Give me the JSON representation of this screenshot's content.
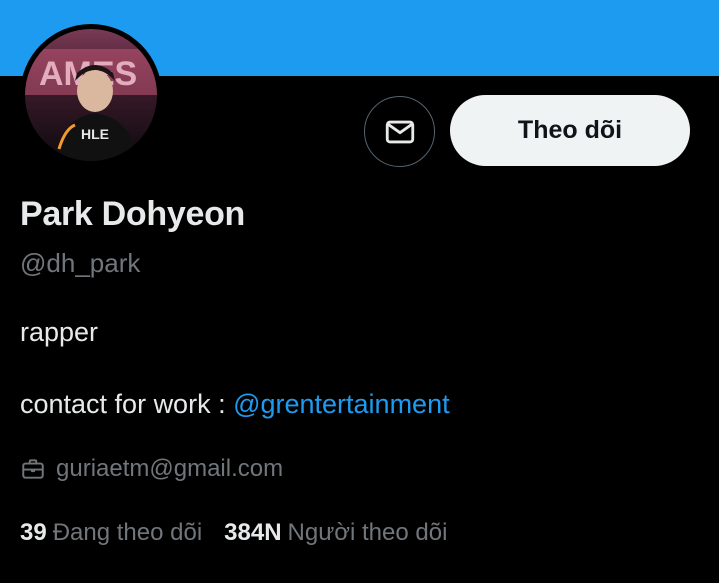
{
  "profile": {
    "display_name": "Park Dohyeon",
    "handle": "@dh_park",
    "bio_line1": "rapper",
    "bio_line2_prefix": "contact for work : ",
    "bio_mention": "@grentertainment",
    "contact_email": "guriaetm@gmail.com",
    "avatar_banner_text": "AMES",
    "avatar_jersey_text": "HLE"
  },
  "actions": {
    "message_icon": "mail-icon",
    "follow_label": "Theo dõi"
  },
  "stats": {
    "following_count": "39",
    "following_label": "Đang theo dõi",
    "followers_count": "384N",
    "followers_label": "Người theo dõi"
  },
  "colors": {
    "banner": "#1d9bf0",
    "background": "#000000",
    "link": "#1d9bf0",
    "muted_text": "#71767b",
    "primary_text": "#e7e9ea",
    "follow_button_bg": "#eff3f4"
  },
  "icons": {
    "contact": "briefcase-icon",
    "message": "mail-icon"
  }
}
